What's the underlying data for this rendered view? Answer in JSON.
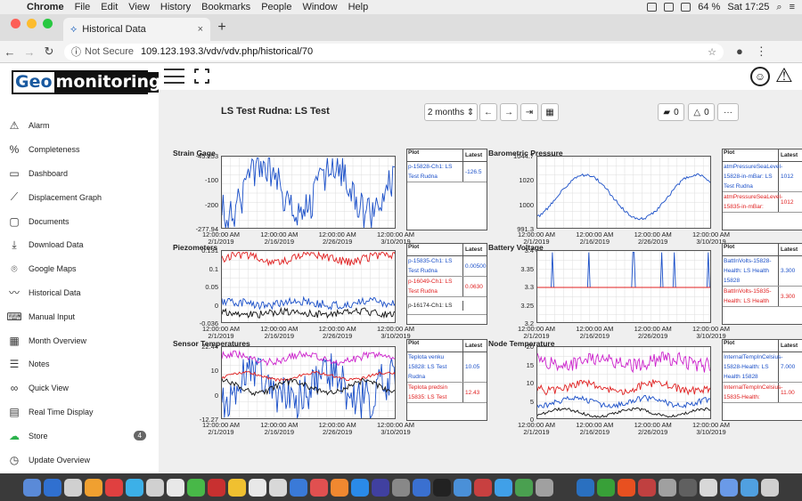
{
  "menubar": {
    "app": "Chrome",
    "items": [
      "File",
      "Edit",
      "View",
      "History",
      "Bookmarks",
      "People",
      "Window",
      "Help"
    ],
    "battery": "64 %",
    "clock": "Sat 17:25"
  },
  "browser": {
    "tab_title": "Historical Data",
    "not_secure": "Not Secure",
    "url": "109.123.193.3/vdv/vdv.php/historical/70"
  },
  "logo": {
    "part1": "Geo",
    "part2": "monitoring"
  },
  "sidebar": {
    "items": [
      {
        "label": "Alarm",
        "icon": "alarm-triangle-icon",
        "glyph": "⚠"
      },
      {
        "label": "Completeness",
        "icon": "percent-icon",
        "glyph": "%"
      },
      {
        "label": "Dashboard",
        "icon": "monitor-icon",
        "glyph": "▭"
      },
      {
        "label": "Displacement Graph",
        "icon": "displacement-graph-icon",
        "glyph": "⟋"
      },
      {
        "label": "Documents",
        "icon": "folder-icon",
        "glyph": "▢"
      },
      {
        "label": "Download Data",
        "icon": "download-icon",
        "glyph": "⤓"
      },
      {
        "label": "Google Maps",
        "icon": "map-pin-icon",
        "glyph": "⌾"
      },
      {
        "label": "Historical Data",
        "icon": "line-chart-icon",
        "glyph": "〰"
      },
      {
        "label": "Manual Input",
        "icon": "keyboard-icon",
        "glyph": "⌨"
      },
      {
        "label": "Month Overview",
        "icon": "calendar-icon",
        "glyph": "▦"
      },
      {
        "label": "Notes",
        "icon": "notes-icon",
        "glyph": "☰"
      },
      {
        "label": "Quick View",
        "icon": "binoculars-icon",
        "glyph": "∞"
      },
      {
        "label": "Real Time Display",
        "icon": "realtime-display-icon",
        "glyph": "▤"
      },
      {
        "label": "Store",
        "icon": "cloud-download-icon",
        "glyph": "☁",
        "badge": "4"
      },
      {
        "label": "Update Overview",
        "icon": "history-clock-icon",
        "glyph": "◷"
      }
    ]
  },
  "toolbar": {
    "title": "LS Test Rudna: LS Test",
    "range": "2 months ⇕",
    "prev": "←",
    "next": "→",
    "end": "⇥",
    "cal": "▦",
    "comments": "0",
    "alerts": "0",
    "more": "···"
  },
  "x_ticks": [
    [
      "12:00:00 AM",
      "2/1/2019"
    ],
    [
      "12:00:00 AM",
      "2/16/2019"
    ],
    [
      "12:00:00 AM",
      "2/26/2019"
    ],
    [
      "12:00:00 AM",
      "3/10/2019"
    ]
  ],
  "legend_hdr": {
    "plot": "Plot",
    "latest": "Latest"
  },
  "panels": [
    {
      "title": "Strain Gage",
      "yticks": [
        "-45.253",
        "-100",
        "-200",
        "-277.94"
      ],
      "rows": [
        {
          "plot": "p-15828-Ch1: LS Test Rudna",
          "latest": "-126.5",
          "color": "#1a4fc8"
        }
      ]
    },
    {
      "title": "Barometric Pressure",
      "yticks": [
        "1044.7",
        "1020",
        "1000",
        "991.3"
      ],
      "rows": [
        {
          "plot": "atmPressureSeaLevel-15828-in-mBar: LS Test Rudna",
          "latest": "1012",
          "color": "#1a4fc8"
        },
        {
          "plot": "atmPressureSeaLevel-15835-in-mBar:",
          "latest": "1012",
          "color": "#e02020"
        }
      ]
    },
    {
      "title": "Piezometers",
      "yticks": [
        "0.131",
        "0.1",
        "0.05",
        "0",
        "-0.036"
      ],
      "rows": [
        {
          "plot": "p-15835-Ch1: LS Test Rudna",
          "latest": "0.00500",
          "color": "#1a4fc8"
        },
        {
          "plot": "p-16049-Ch1: LS Test Rudna",
          "latest": "0.0630",
          "color": "#e02020"
        },
        {
          "plot": "p-16174-Ch1: LS",
          "latest": "",
          "color": "#222"
        }
      ]
    },
    {
      "title": "Battery Voltage",
      "yticks": [
        "3.4",
        "3.35",
        "3.3",
        "3.25",
        "3.2"
      ],
      "rows": [
        {
          "plot": "BattInVolts-15828-Health: LS Health 15828",
          "latest": "3.300",
          "color": "#1a4fc8"
        },
        {
          "plot": "BattInVolts-15835-Health: LS Health",
          "latest": "3.300",
          "color": "#e02020"
        }
      ]
    },
    {
      "title": "Sensor Temperatures",
      "yticks": [
        "22.44",
        "10",
        "0",
        "-12.27"
      ],
      "rows": [
        {
          "plot": "Teplota venku 15828: LS Test Rudna",
          "latest": "10.05",
          "color": "#1a4fc8"
        },
        {
          "plot": "Teplota predsin 15835: LS Test",
          "latest": "12.43",
          "color": "#e02020"
        }
      ]
    },
    {
      "title": "Node Temperature",
      "yticks": [
        "20",
        "15",
        "10",
        "5",
        "0"
      ],
      "rows": [
        {
          "plot": "InternalTempInCelsius-15828-Health: LS Health 15828",
          "latest": "7.000",
          "color": "#1a4fc8"
        },
        {
          "plot": "InternalTempInCelsius-15835-Health:",
          "latest": "11.00",
          "color": "#e02020"
        }
      ]
    }
  ]
}
